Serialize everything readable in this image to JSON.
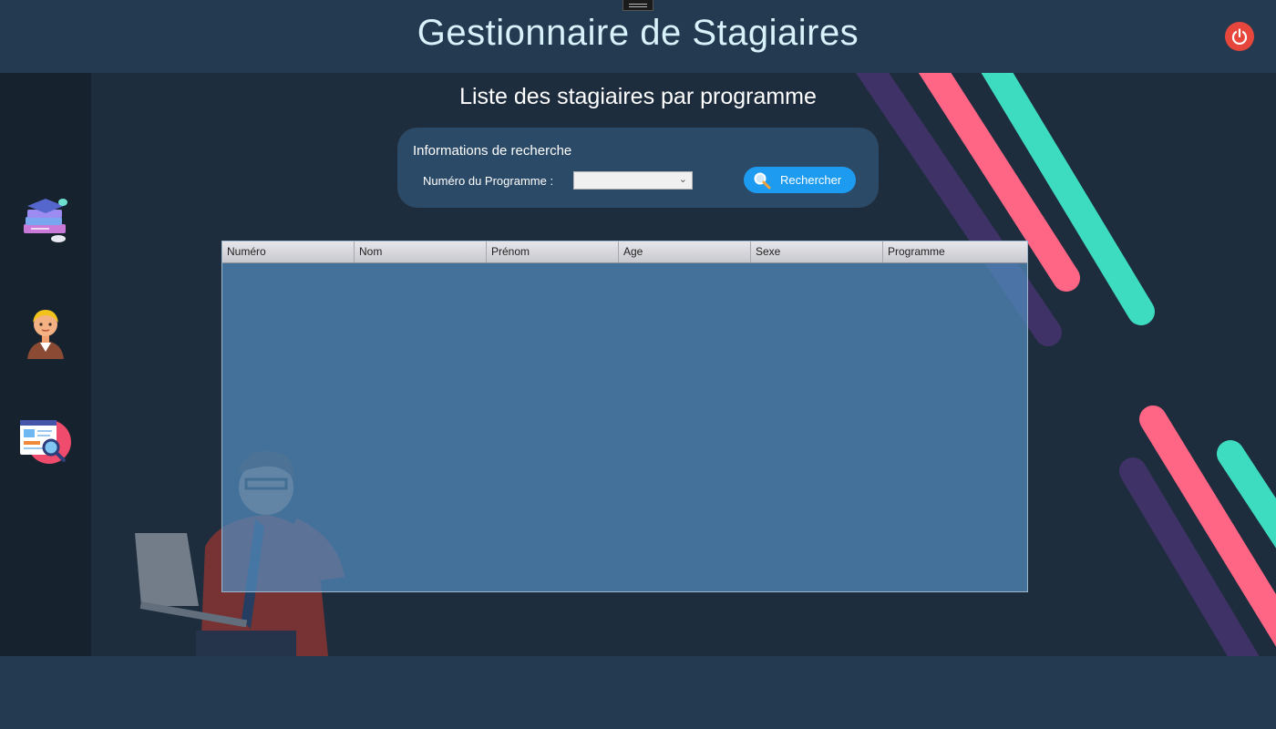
{
  "app": {
    "title": "Gestionnaire de Stagiaires"
  },
  "window": {
    "power_icon": "power-icon"
  },
  "sidebar": {
    "items": [
      {
        "icon": "books-graduation-icon"
      },
      {
        "icon": "student-avatar-icon"
      },
      {
        "icon": "search-document-icon"
      }
    ]
  },
  "page": {
    "title": "Liste des stagiaires par programme"
  },
  "search": {
    "panel_title": "Informations de recherche",
    "program_label": "Numéro du Programme :",
    "program_value": "",
    "button_label": "Rechercher"
  },
  "table": {
    "columns": [
      "Numéro",
      "Nom",
      "Prénom",
      "Age",
      "Sexe",
      "Programme"
    ],
    "rows": []
  },
  "theme": {
    "header_bg": "#243a51",
    "body_bg": "#1e2d3d",
    "accent_blue": "#1d9bf0",
    "stripe_pink": "#ff6584",
    "stripe_teal": "#3ddbbf",
    "stripe_purple": "#3f3266",
    "power_red": "#e6463c"
  }
}
